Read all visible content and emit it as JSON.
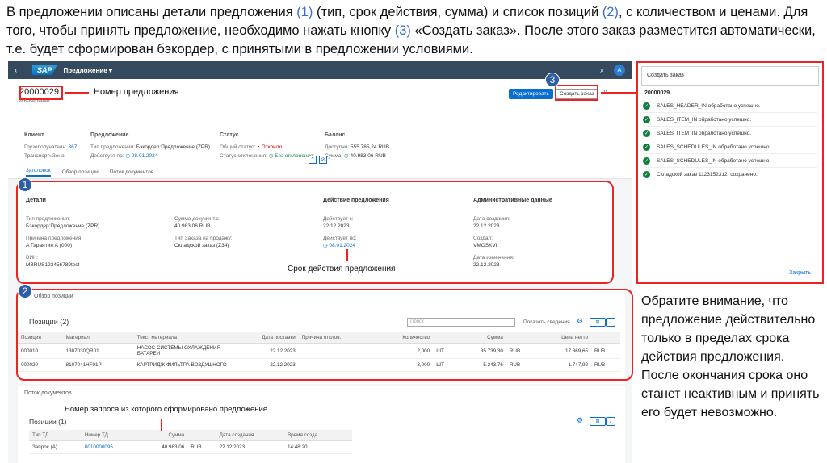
{
  "intro": {
    "part1": "В предложении описаны детали предложения ",
    "ref1": "(1)",
    "part2": " (тип, срок действия, сумма) и список позиций ",
    "ref2": "(2)",
    "part3": ", с количеством и ценами. Для того, чтобы принять предложение, необходимо нажать кнопку ",
    "ref3": "(3)",
    "part4": " «Создать заказ». После этого заказ разместится автоматически, т.е. будет сформирован бэкордер, с принятыми в предложении условиями."
  },
  "shell": {
    "back": "‹",
    "logo": "SAP",
    "title": "Предложение ▾",
    "search": "⌕",
    "avatar": "A"
  },
  "header": {
    "id": "20000029",
    "subtitle": "МБ-Беляево",
    "edit_button": "Редактировать",
    "create_button": "Создать заказ",
    "client": {
      "title": "Клиент",
      "l1": "Грузополучатель:",
      "v1": "367",
      "l2": "ТранспортнЗона:",
      "v2": "--"
    },
    "offer": {
      "title": "Предложение",
      "l1": "Тип предложения:",
      "v1": "Бэкордер:Предложение (ZPR)",
      "l2": "Действует по:",
      "v2": "08.01.2024"
    },
    "status": {
      "title": "Статус",
      "l1": "Общий статус:",
      "v1": "Открыто",
      "l2": "Статус отклонения:",
      "v2": "Без отклонения"
    },
    "balance": {
      "title": "Баланс",
      "l1": "Доступно:",
      "v1": "555.785,24 RUB",
      "l2": "Сумма:",
      "v2": "40.983,06 RUB"
    }
  },
  "tabs": [
    "Заголовок",
    "Обзор позиции",
    "Поток документов"
  ],
  "details": {
    "col1": {
      "title": "Детали",
      "l1": "Тип предложения:",
      "v1": "Бэкордер:Предложение (ZPR)",
      "l2": "Причина предложения:",
      "v2": "А Гарантия А (000)",
      "l3": "ВИН:",
      "v3": "MBRUS123456789test"
    },
    "col2": {
      "l1": "Сумма документа:",
      "v1": "40.983,06 RUB",
      "l2": "Тип Заказа на продажу:",
      "v2": "Складской заказ (Z34)"
    },
    "col3": {
      "title": "Действие предложения",
      "l1": "Действует с:",
      "v1": "22.12.2023",
      "l2": "Действует по:",
      "v2": "08.01.2024"
    },
    "col4": {
      "title": "Административные данные",
      "l1": "Дата создания:",
      "v1": "22.12.2023",
      "l2": "Создал:",
      "v2": "VMOSKVI",
      "l3": "Дата изменения:",
      "v3": "22.12.2023"
    },
    "validity_label": "Срок действия предложения"
  },
  "positions": {
    "section_title": "Обзор позиции",
    "title": "Позиции (2)",
    "search_placeholder": "Поиск",
    "show_details": "Показать сведения",
    "columns": [
      "Позиция",
      "Материал",
      "Текст материала",
      "Дата поставки",
      "Причина отклон.",
      "Количество",
      "",
      "Сумма",
      "",
      "Цена нетто",
      ""
    ],
    "rows": [
      [
        "000010",
        "1307030QR01",
        "НАСОС СИСТЕМЫ ОХЛАЖДЕНИЯ БАТАРЕИ",
        "22.12.2023",
        "",
        "2,000",
        "ШТ",
        "35.739,30",
        "RUB",
        "17.869,65",
        "RUB"
      ],
      [
        "000020",
        "8107041HF01P",
        "КАРТРИДЖ ФИЛЬТРА ВОЗДУШНОГО",
        "22.12.2023",
        "",
        "3,000",
        "ШТ",
        "5.243,76",
        "RUB",
        "1.747,92",
        "RUB"
      ]
    ]
  },
  "docflow": {
    "section_title": "Поток документов",
    "request_label": "Номер запроса из которого сформировано предложение",
    "title": "Позиции (1)",
    "columns": [
      "Тип ТД",
      "Номер ТД",
      "Сумма",
      "",
      "Дата создания",
      "Время созда..."
    ],
    "rows": [
      [
        "Запрос (А)",
        "0010000095",
        "40.983,06",
        "RUB",
        "22.12.2023",
        "14:48:20"
      ]
    ]
  },
  "annotations": {
    "offer_number_label": "Номер предложения",
    "b1": "1",
    "b2": "2",
    "b3": "3"
  },
  "panel": {
    "header": "Создать заказ",
    "id": "20000029",
    "messages": [
      "SALES_HEADER_IN обработано успешно.",
      "SALES_ITEM_IN обработано успешно.",
      "SALES_ITEM_IN обработано успешно.",
      "SALES_SCHEDULES_IN обработано успешно.",
      "SALES_SCHEDULES_IN обработано успешно.",
      "Складской заказ 1123152312: сохранено."
    ],
    "close": "Закрыть"
  },
  "note_right": "Обратите внимание, что предложение действительно только в пределах срока действия предложения. После окончания срока оно станет неактивным и принять его будет невозможно.",
  "colors": {
    "shell": "#354a5f",
    "accent": "#0a6ed1",
    "annotation": "#ee2222",
    "badge": "#2e5ea8",
    "success": "#107e3e"
  }
}
